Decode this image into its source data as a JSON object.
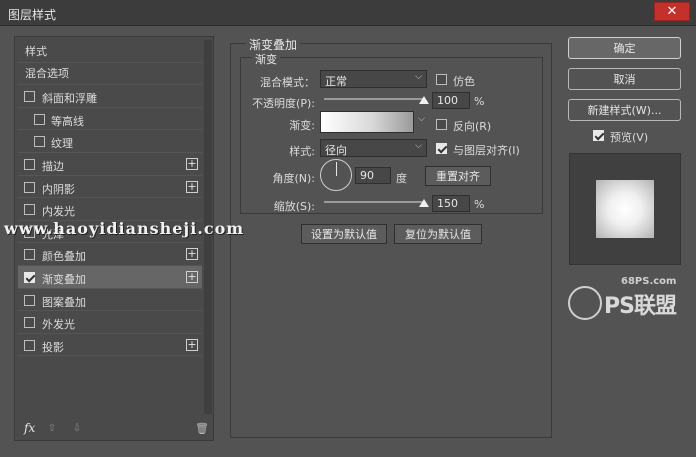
{
  "window": {
    "title": "图层样式",
    "close_glyph": "✕"
  },
  "left_panel": {
    "items": [
      {
        "label": "样式",
        "type": "header"
      },
      {
        "label": "混合选项",
        "type": "header"
      },
      {
        "label": "斜面和浮雕",
        "checked": false,
        "sub": false,
        "has_plus": false
      },
      {
        "label": "等高线",
        "checked": false,
        "sub": true,
        "has_plus": false
      },
      {
        "label": "纹理",
        "checked": false,
        "sub": true,
        "has_plus": false
      },
      {
        "label": "描边",
        "checked": false,
        "sub": false,
        "has_plus": true
      },
      {
        "label": "内阴影",
        "checked": false,
        "sub": false,
        "has_plus": true
      },
      {
        "label": "内发光",
        "checked": false,
        "sub": false,
        "has_plus": false
      },
      {
        "label": "光泽",
        "checked": false,
        "sub": false,
        "has_plus": false
      },
      {
        "label": "颜色叠加",
        "checked": false,
        "sub": false,
        "has_plus": true
      },
      {
        "label": "渐变叠加",
        "checked": true,
        "sub": false,
        "has_plus": true,
        "selected": true
      },
      {
        "label": "图案叠加",
        "checked": false,
        "sub": false,
        "has_plus": false
      },
      {
        "label": "外发光",
        "checked": false,
        "sub": false,
        "has_plus": false
      },
      {
        "label": "投影",
        "checked": false,
        "sub": false,
        "has_plus": true
      }
    ],
    "plus_glyph": "+",
    "footer": {
      "fx": "fx",
      "up": "⇧",
      "down": "⇩",
      "trash": "🗑"
    }
  },
  "watermark": "www.haoyidiansheji.com",
  "gradient_overlay": {
    "group_title": "渐变叠加",
    "inner_title": "渐变",
    "blend_mode": {
      "label": "混合模式：",
      "value": "正常"
    },
    "dither": {
      "label": "仿色",
      "checked": false
    },
    "opacity": {
      "label": "不透明度(P):",
      "value": "100",
      "unit": "%",
      "fraction": 1.0
    },
    "gradient": {
      "label": "渐变:"
    },
    "reverse": {
      "label": "反向(R)",
      "checked": false
    },
    "style": {
      "label": "样式:",
      "value": "径向"
    },
    "align_layer": {
      "label": "与图层对齐(I)",
      "checked": true
    },
    "angle": {
      "label": "角度(N):",
      "value": "90",
      "unit": "度"
    },
    "reset_align": "重置对齐",
    "scale": {
      "label": "缩放(S):",
      "value": "150",
      "unit": "%",
      "fraction": 1.0
    },
    "set_default": "设置为默认值",
    "reset_default": "复位为默认值"
  },
  "right_panel": {
    "ok": "确定",
    "cancel": "取消",
    "new_style": "新建样式(W)...",
    "preview": {
      "label": "预览(V)",
      "checked": true
    }
  },
  "brand": {
    "site": "68PS.com",
    "name": "PS联盟"
  },
  "colors": {
    "dialog_bg": "#535353",
    "title_bar": "#3c3c3c",
    "close_red": "#c4302b"
  }
}
